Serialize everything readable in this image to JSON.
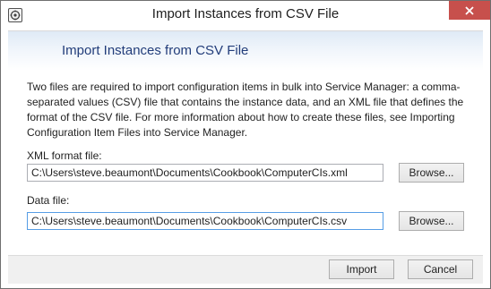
{
  "window": {
    "title": "Import Instances from CSV File",
    "app_icon": "service-manager-icon",
    "close_icon": "close-icon"
  },
  "header": {
    "title": "Import Instances from CSV File"
  },
  "description": "Two files are required to import configuration items in bulk into Service Manager: a comma-separated values (CSV) file that contains the instance data, and an XML file that defines the format of the CSV file. For more information about how to create these files, see Importing Configuration Item Files into Service Manager.",
  "xml_format": {
    "label": "XML format file:",
    "value": "C:\\Users\\steve.beaumont\\Documents\\Cookbook\\ComputerCIs.xml",
    "browse_label": "Browse..."
  },
  "data_file": {
    "label": "Data file:",
    "value": "C:\\Users\\steve.beaumont\\Documents\\Cookbook\\ComputerCIs.csv",
    "browse_label": "Browse..."
  },
  "footer": {
    "import_label": "Import",
    "cancel_label": "Cancel"
  },
  "colors": {
    "close_button": "#c7504c",
    "header_title": "#223d7a",
    "focus_border": "#569de5"
  }
}
